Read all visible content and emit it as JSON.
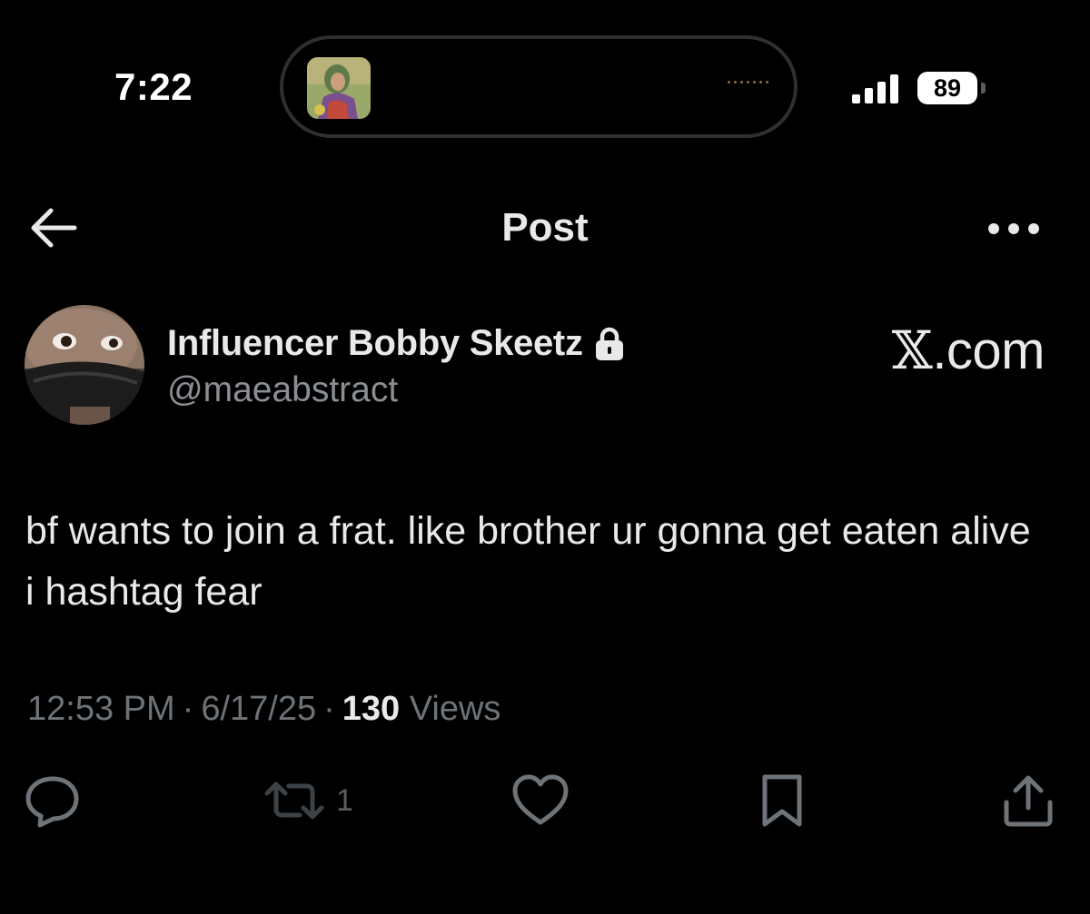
{
  "status_bar": {
    "time": "7:22",
    "battery": "89"
  },
  "header": {
    "title": "Post",
    "back_icon": "arrow-left-icon",
    "more_icon": "more-horizontal-icon"
  },
  "author": {
    "display_name": "Influencer Bobby Skeetz",
    "handle": "@maeabstract",
    "protected_icon": "lock-icon"
  },
  "watermark": {
    "x_mark": "𝕏",
    "suffix": ".com"
  },
  "post": {
    "text": "bf wants to join a frat. like brother ur gonna get eaten alive i hashtag fear",
    "time": "12:53 PM",
    "date": "6/17/25",
    "separator": "·",
    "views_count": "130",
    "views_label": "Views"
  },
  "actions": {
    "reply_icon": "reply-icon",
    "repost_icon": "repost-icon",
    "repost_count": "1",
    "like_icon": "heart-icon",
    "bookmark_icon": "bookmark-icon",
    "share_icon": "share-icon"
  },
  "colors": {
    "background": "#000000",
    "text_primary": "#e7e9ea",
    "text_secondary": "#8b8f94",
    "text_meta": "#6e7378",
    "icon_gray": "#6e7378"
  }
}
